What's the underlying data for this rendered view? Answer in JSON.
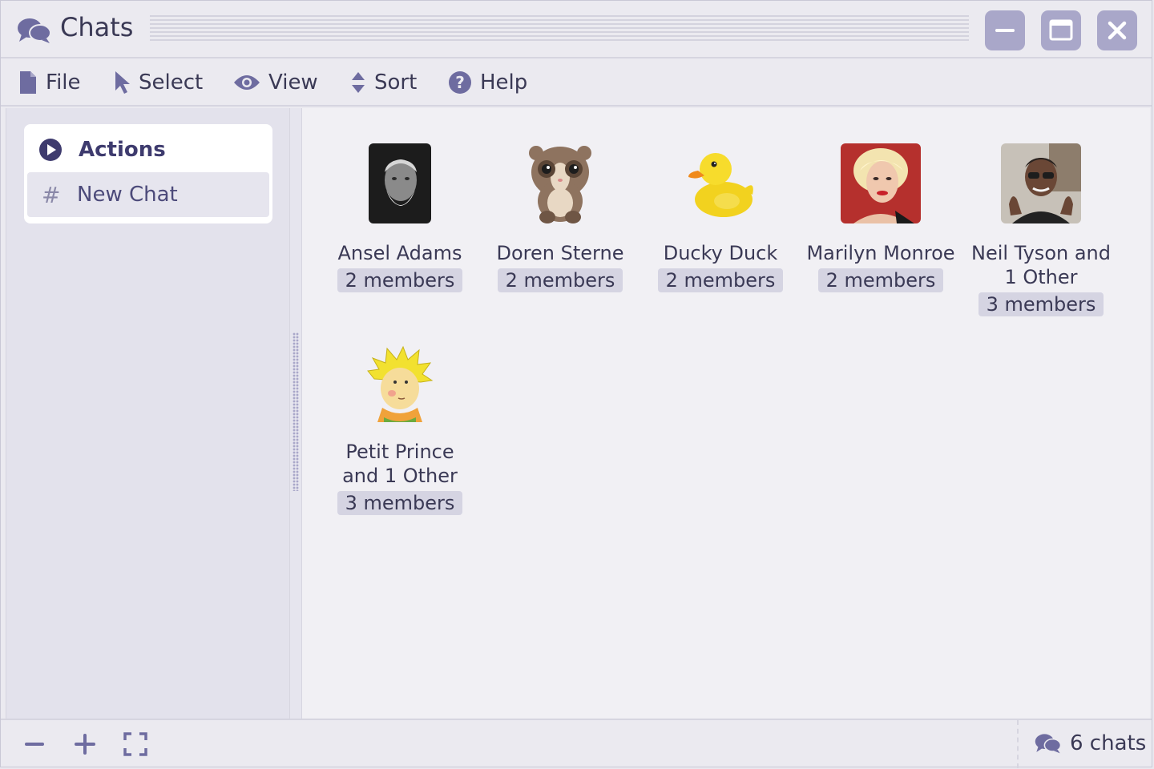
{
  "window": {
    "title": "Chats",
    "app_icon": "chat-bubbles-icon",
    "controls": [
      "minimize-icon",
      "maximize-icon",
      "close-icon"
    ]
  },
  "menu": [
    {
      "label": "File",
      "icon": "file-icon"
    },
    {
      "label": "Select",
      "icon": "cursor-icon"
    },
    {
      "label": "View",
      "icon": "eye-icon"
    },
    {
      "label": "Sort",
      "icon": "sort-icon"
    },
    {
      "label": "Help",
      "icon": "help-icon"
    }
  ],
  "sidebar": {
    "actions_title": "Actions",
    "actions_icon": "play-circle-icon",
    "items": [
      {
        "label": "New Chat",
        "icon": "#"
      }
    ]
  },
  "chats": [
    {
      "name": "Ansel Adams",
      "members": "2 members",
      "avatar": "bearded-man-photo"
    },
    {
      "name": "Doren Sterne",
      "members": "2 members",
      "avatar": "loris-cartoon"
    },
    {
      "name": "Ducky Duck",
      "members": "2 members",
      "avatar": "rubber-duck"
    },
    {
      "name": "Marilyn Monroe",
      "members": "2 members",
      "avatar": "woman-portrait-photo"
    },
    {
      "name": "Neil Tyson and 1 Other",
      "members": "3 members",
      "avatar": "man-thumbs-up-photo"
    },
    {
      "name": "Petit Prince and 1 Other",
      "members": "3 members",
      "avatar": "little-prince-drawing"
    }
  ],
  "statusbar": {
    "zoom_out_icon": "minus-icon",
    "zoom_in_icon": "plus-icon",
    "fullscreen_icon": "expand-icon",
    "count": "6 chats",
    "count_icon": "chat-bubbles-icon"
  },
  "colors": {
    "accent": "#a9a7c9",
    "text": "#3a3955",
    "badge": "#d5d4e2",
    "background": "#ebeaf0"
  }
}
